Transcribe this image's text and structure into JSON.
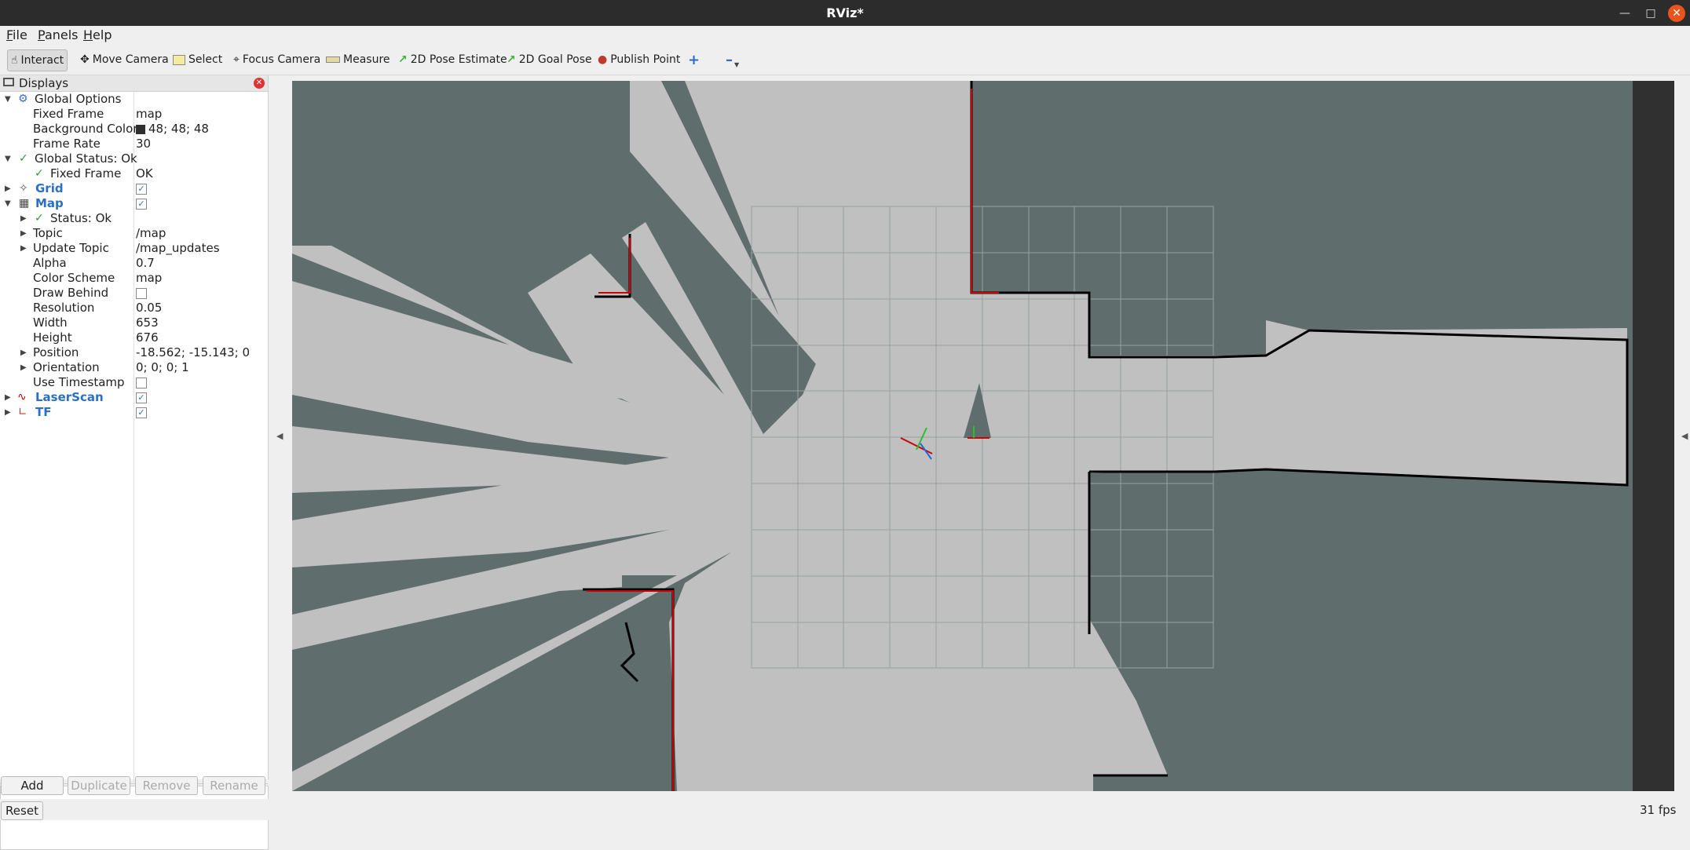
{
  "window": {
    "title": "RViz*"
  },
  "menu": {
    "file": "File",
    "panels": "Panels",
    "help": "Help"
  },
  "toolbar": {
    "interact": "Interact",
    "move_camera": "Move Camera",
    "select": "Select",
    "focus_camera": "Focus Camera",
    "measure": "Measure",
    "pose_estimate": "2D Pose Estimate",
    "goal_pose": "2D Goal Pose",
    "publish_point": "Publish Point"
  },
  "displays": {
    "title": "Displays",
    "global_options": "Global Options",
    "fixed_frame_label": "Fixed Frame",
    "fixed_frame_value": "map",
    "bg_color_label": "Background Color",
    "bg_color_value": "48; 48; 48",
    "frame_rate_label": "Frame Rate",
    "frame_rate_value": "30",
    "global_status": "Global Status: Ok",
    "gs_fixed_frame_label": "Fixed Frame",
    "gs_fixed_frame_value": "OK",
    "grid": "Grid",
    "map": "Map",
    "map_status": "Status: Ok",
    "topic_label": "Topic",
    "topic_value": "/map",
    "update_topic_label": "Update Topic",
    "update_topic_value": "/map_updates",
    "alpha_label": "Alpha",
    "alpha_value": "0.7",
    "color_scheme_label": "Color Scheme",
    "color_scheme_value": "map",
    "draw_behind_label": "Draw Behind",
    "resolution_label": "Resolution",
    "resolution_value": "0.05",
    "width_label": "Width",
    "width_value": "653",
    "height_label": "Height",
    "height_value": "676",
    "position_label": "Position",
    "position_value": "-18.562; -15.143; 0",
    "orientation_label": "Orientation",
    "orientation_value": "0; 0; 0; 1",
    "use_timestamp_label": "Use Timestamp",
    "laserscan": "LaserScan",
    "tf": "TF"
  },
  "buttons": {
    "add": "Add",
    "duplicate": "Duplicate",
    "remove": "Remove",
    "rename": "Rename"
  },
  "status": {
    "reset": "Reset",
    "fps": "31 fps"
  },
  "colors": {
    "background": "#5f6e6c",
    "free_space": "#c0c0c0",
    "laser": "#cc0000",
    "link": "#2a6fc2"
  }
}
